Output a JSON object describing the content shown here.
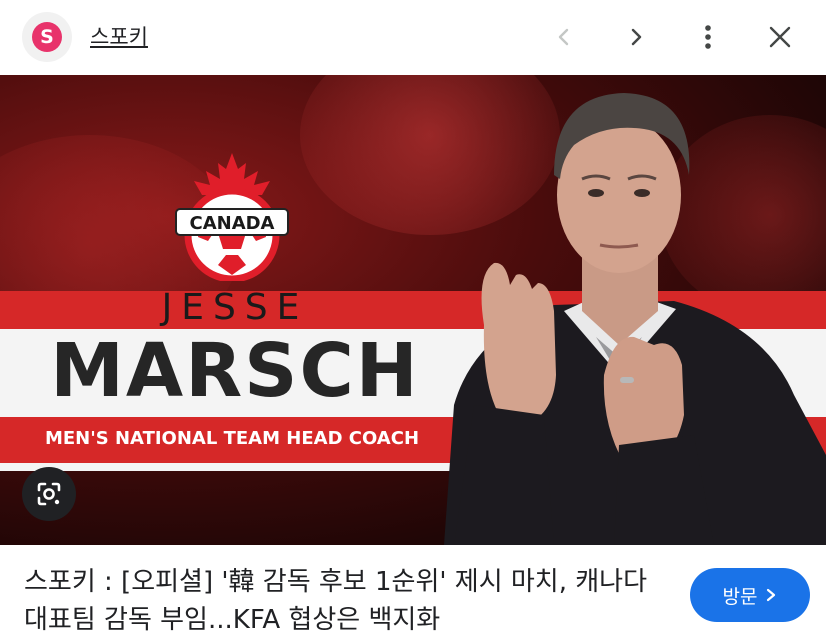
{
  "header": {
    "site_logo_letter": "S",
    "site_name": "스포키",
    "icons": {
      "prev": "chevron-left-icon",
      "next": "chevron-right-icon",
      "more": "more-vert-icon",
      "close": "close-icon"
    }
  },
  "image": {
    "crest_text": "CANADA",
    "first_name": "JESSE",
    "last_name": "MARSCH",
    "role": "MEN'S NATIONAL TEAM HEAD COACH",
    "lens_icon": "lens-search-icon"
  },
  "caption": {
    "text": "스포키 : [오피셜] '韓 감독 후보 1순위' 제시 마치, 캐나다 대표팀 감독 부임...KFA 협상은 백지화"
  },
  "visit_button": {
    "label": "방문",
    "icon": "chevron-right-icon"
  },
  "colors": {
    "accent_red": "#d62828",
    "logo_pink": "#e8336b",
    "button_blue": "#1a73e8"
  }
}
